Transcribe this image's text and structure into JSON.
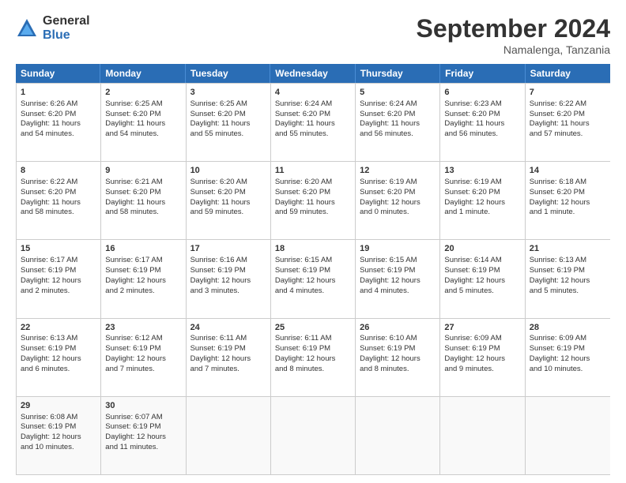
{
  "logo": {
    "general": "General",
    "blue": "Blue"
  },
  "title": "September 2024",
  "subtitle": "Namalenga, Tanzania",
  "header_days": [
    "Sunday",
    "Monday",
    "Tuesday",
    "Wednesday",
    "Thursday",
    "Friday",
    "Saturday"
  ],
  "weeks": [
    [
      {
        "day": "1",
        "lines": [
          "Sunrise: 6:26 AM",
          "Sunset: 6:20 PM",
          "Daylight: 11 hours",
          "and 54 minutes."
        ]
      },
      {
        "day": "2",
        "lines": [
          "Sunrise: 6:25 AM",
          "Sunset: 6:20 PM",
          "Daylight: 11 hours",
          "and 54 minutes."
        ]
      },
      {
        "day": "3",
        "lines": [
          "Sunrise: 6:25 AM",
          "Sunset: 6:20 PM",
          "Daylight: 11 hours",
          "and 55 minutes."
        ]
      },
      {
        "day": "4",
        "lines": [
          "Sunrise: 6:24 AM",
          "Sunset: 6:20 PM",
          "Daylight: 11 hours",
          "and 55 minutes."
        ]
      },
      {
        "day": "5",
        "lines": [
          "Sunrise: 6:24 AM",
          "Sunset: 6:20 PM",
          "Daylight: 11 hours",
          "and 56 minutes."
        ]
      },
      {
        "day": "6",
        "lines": [
          "Sunrise: 6:23 AM",
          "Sunset: 6:20 PM",
          "Daylight: 11 hours",
          "and 56 minutes."
        ]
      },
      {
        "day": "7",
        "lines": [
          "Sunrise: 6:22 AM",
          "Sunset: 6:20 PM",
          "Daylight: 11 hours",
          "and 57 minutes."
        ]
      }
    ],
    [
      {
        "day": "8",
        "lines": [
          "Sunrise: 6:22 AM",
          "Sunset: 6:20 PM",
          "Daylight: 11 hours",
          "and 58 minutes."
        ]
      },
      {
        "day": "9",
        "lines": [
          "Sunrise: 6:21 AM",
          "Sunset: 6:20 PM",
          "Daylight: 11 hours",
          "and 58 minutes."
        ]
      },
      {
        "day": "10",
        "lines": [
          "Sunrise: 6:20 AM",
          "Sunset: 6:20 PM",
          "Daylight: 11 hours",
          "and 59 minutes."
        ]
      },
      {
        "day": "11",
        "lines": [
          "Sunrise: 6:20 AM",
          "Sunset: 6:20 PM",
          "Daylight: 11 hours",
          "and 59 minutes."
        ]
      },
      {
        "day": "12",
        "lines": [
          "Sunrise: 6:19 AM",
          "Sunset: 6:20 PM",
          "Daylight: 12 hours",
          "and 0 minutes."
        ]
      },
      {
        "day": "13",
        "lines": [
          "Sunrise: 6:19 AM",
          "Sunset: 6:20 PM",
          "Daylight: 12 hours",
          "and 1 minute."
        ]
      },
      {
        "day": "14",
        "lines": [
          "Sunrise: 6:18 AM",
          "Sunset: 6:20 PM",
          "Daylight: 12 hours",
          "and 1 minute."
        ]
      }
    ],
    [
      {
        "day": "15",
        "lines": [
          "Sunrise: 6:17 AM",
          "Sunset: 6:19 PM",
          "Daylight: 12 hours",
          "and 2 minutes."
        ]
      },
      {
        "day": "16",
        "lines": [
          "Sunrise: 6:17 AM",
          "Sunset: 6:19 PM",
          "Daylight: 12 hours",
          "and 2 minutes."
        ]
      },
      {
        "day": "17",
        "lines": [
          "Sunrise: 6:16 AM",
          "Sunset: 6:19 PM",
          "Daylight: 12 hours",
          "and 3 minutes."
        ]
      },
      {
        "day": "18",
        "lines": [
          "Sunrise: 6:15 AM",
          "Sunset: 6:19 PM",
          "Daylight: 12 hours",
          "and 4 minutes."
        ]
      },
      {
        "day": "19",
        "lines": [
          "Sunrise: 6:15 AM",
          "Sunset: 6:19 PM",
          "Daylight: 12 hours",
          "and 4 minutes."
        ]
      },
      {
        "day": "20",
        "lines": [
          "Sunrise: 6:14 AM",
          "Sunset: 6:19 PM",
          "Daylight: 12 hours",
          "and 5 minutes."
        ]
      },
      {
        "day": "21",
        "lines": [
          "Sunrise: 6:13 AM",
          "Sunset: 6:19 PM",
          "Daylight: 12 hours",
          "and 5 minutes."
        ]
      }
    ],
    [
      {
        "day": "22",
        "lines": [
          "Sunrise: 6:13 AM",
          "Sunset: 6:19 PM",
          "Daylight: 12 hours",
          "and 6 minutes."
        ]
      },
      {
        "day": "23",
        "lines": [
          "Sunrise: 6:12 AM",
          "Sunset: 6:19 PM",
          "Daylight: 12 hours",
          "and 7 minutes."
        ]
      },
      {
        "day": "24",
        "lines": [
          "Sunrise: 6:11 AM",
          "Sunset: 6:19 PM",
          "Daylight: 12 hours",
          "and 7 minutes."
        ]
      },
      {
        "day": "25",
        "lines": [
          "Sunrise: 6:11 AM",
          "Sunset: 6:19 PM",
          "Daylight: 12 hours",
          "and 8 minutes."
        ]
      },
      {
        "day": "26",
        "lines": [
          "Sunrise: 6:10 AM",
          "Sunset: 6:19 PM",
          "Daylight: 12 hours",
          "and 8 minutes."
        ]
      },
      {
        "day": "27",
        "lines": [
          "Sunrise: 6:09 AM",
          "Sunset: 6:19 PM",
          "Daylight: 12 hours",
          "and 9 minutes."
        ]
      },
      {
        "day": "28",
        "lines": [
          "Sunrise: 6:09 AM",
          "Sunset: 6:19 PM",
          "Daylight: 12 hours",
          "and 10 minutes."
        ]
      }
    ],
    [
      {
        "day": "29",
        "lines": [
          "Sunrise: 6:08 AM",
          "Sunset: 6:19 PM",
          "Daylight: 12 hours",
          "and 10 minutes."
        ]
      },
      {
        "day": "30",
        "lines": [
          "Sunrise: 6:07 AM",
          "Sunset: 6:19 PM",
          "Daylight: 12 hours",
          "and 11 minutes."
        ]
      },
      {
        "day": "",
        "lines": []
      },
      {
        "day": "",
        "lines": []
      },
      {
        "day": "",
        "lines": []
      },
      {
        "day": "",
        "lines": []
      },
      {
        "day": "",
        "lines": []
      }
    ]
  ]
}
